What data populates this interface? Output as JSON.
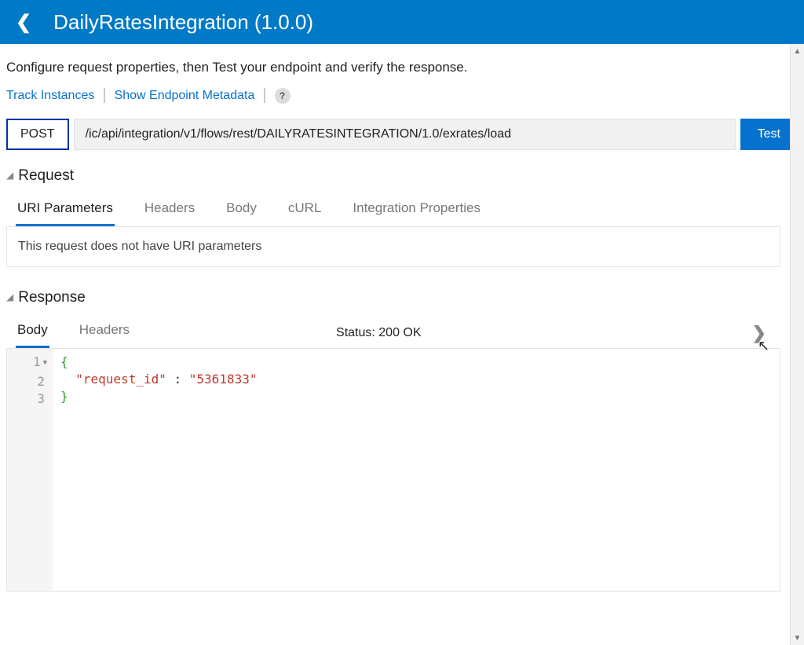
{
  "header": {
    "title": "DailyRatesIntegration (1.0.0)"
  },
  "description": "Configure request properties, then Test your endpoint and verify the response.",
  "links": {
    "track": "Track Instances",
    "metadata": "Show Endpoint Metadata"
  },
  "urlbar": {
    "method": "POST",
    "url": "/ic/api/integration/v1/flows/rest/DAILYRATESINTEGRATION/1.0/exrates/load",
    "test": "Test"
  },
  "request": {
    "title": "Request",
    "tabs": [
      "URI Parameters",
      "Headers",
      "Body",
      "cURL",
      "Integration Properties"
    ],
    "active_tab_index": 0,
    "empty_msg": "This request does not have URI parameters"
  },
  "response": {
    "title": "Response",
    "tabs": [
      "Body",
      "Headers"
    ],
    "active_tab_index": 0,
    "status_label": "Status:",
    "status_value": "200 OK",
    "body_lines": [
      {
        "n": "1",
        "fold": true,
        "text": "{"
      },
      {
        "n": "2",
        "fold": false,
        "text": "  \"request_id\" : \"5361833\""
      },
      {
        "n": "3",
        "fold": false,
        "text": "}"
      }
    ],
    "body_json": {
      "request_id": "5361833"
    }
  }
}
